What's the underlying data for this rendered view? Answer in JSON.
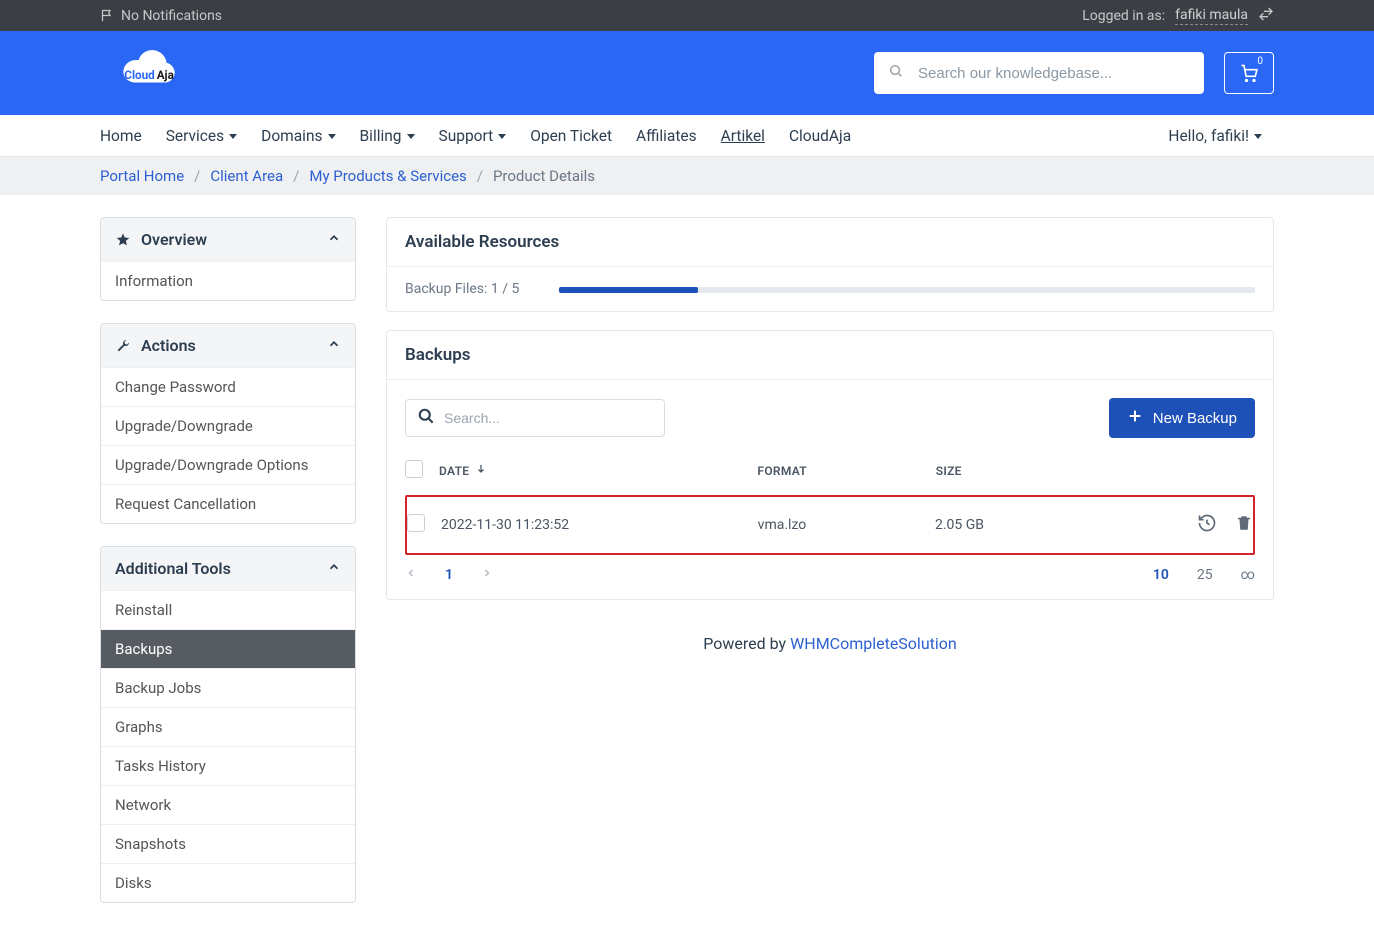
{
  "topbar": {
    "no_notifications": "No Notifications",
    "logged_in_as": "Logged in as:",
    "username": "fafiki maula"
  },
  "header": {
    "search_placeholder": "Search our knowledgebase...",
    "cart_count": "0"
  },
  "nav": {
    "home": "Home",
    "services": "Services",
    "domains": "Domains",
    "billing": "Billing",
    "support": "Support",
    "open_ticket": "Open Ticket",
    "affiliates": "Affiliates",
    "artikel": "Artikel",
    "cloudaja": "CloudAja",
    "hello": "Hello, fafiki!"
  },
  "breadcrumb": {
    "portal_home": "Portal Home",
    "client_area": "Client Area",
    "my_products": "My Products & Services",
    "product_details": "Product Details"
  },
  "sidebar": {
    "overview": {
      "title": "Overview",
      "information": "Information"
    },
    "actions": {
      "title": "Actions",
      "change_password": "Change Password",
      "upgrade": "Upgrade/Downgrade",
      "upgrade_options": "Upgrade/Downgrade Options",
      "request_cancellation": "Request Cancellation"
    },
    "tools": {
      "title": "Additional Tools",
      "reinstall": "Reinstall",
      "backups": "Backups",
      "backup_jobs": "Backup Jobs",
      "graphs": "Graphs",
      "tasks_history": "Tasks History",
      "network": "Network",
      "snapshots": "Snapshots",
      "disks": "Disks"
    }
  },
  "resources": {
    "title": "Available Resources",
    "backup_label": "Backup Files: 1 / 5",
    "backup_pct": 20
  },
  "backups": {
    "title": "Backups",
    "search_placeholder": "Search...",
    "new_button": "New Backup",
    "cols": {
      "date": "DATE",
      "format": "FORMAT",
      "size": "SIZE"
    },
    "rows": [
      {
        "date": "2022-11-30 11:23:52",
        "format": "vma.lzo",
        "size": "2.05 GB"
      }
    ],
    "pager": {
      "current": "1",
      "size10": "10",
      "size25": "25",
      "inf": "∞"
    }
  },
  "footer": {
    "powered": "Powered by ",
    "whm": "WHMCompleteSolution"
  }
}
